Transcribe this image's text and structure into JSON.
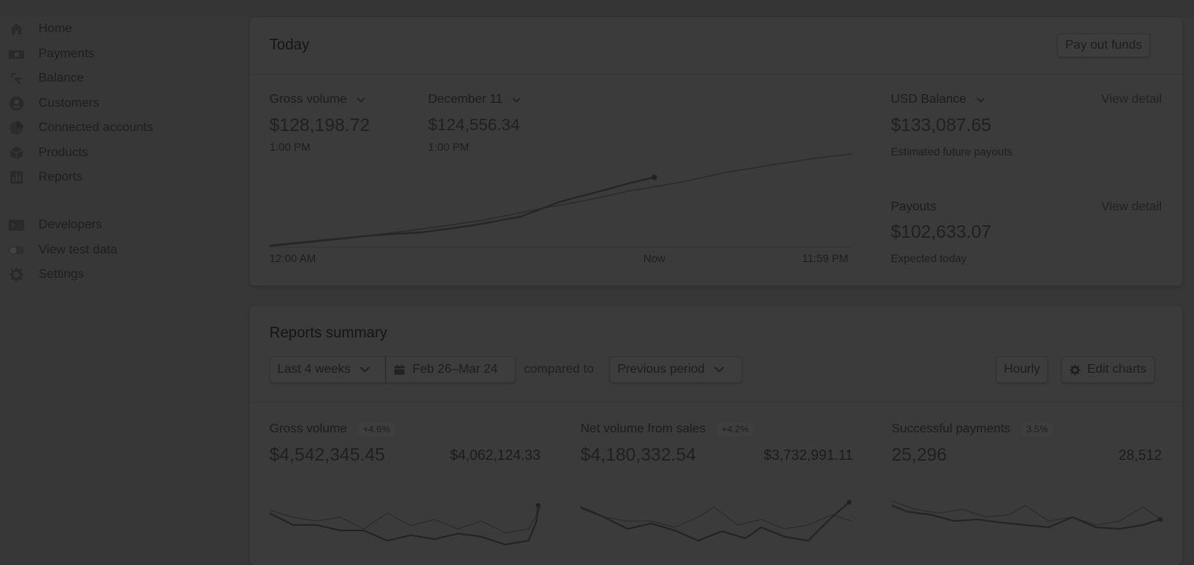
{
  "sidebar": {
    "items": [
      {
        "label": "Home",
        "icon": "home-icon"
      },
      {
        "label": "Payments",
        "icon": "payments-icon"
      },
      {
        "label": "Balance",
        "icon": "balance-icon"
      },
      {
        "label": "Customers",
        "icon": "customers-icon"
      },
      {
        "label": "Connected accounts",
        "icon": "connected-accounts-icon"
      },
      {
        "label": "Products",
        "icon": "products-icon"
      },
      {
        "label": "Reports",
        "icon": "reports-icon"
      },
      {
        "label": "Developers",
        "icon": "developers-icon"
      },
      {
        "label": "View test data",
        "icon": "toggle-icon"
      },
      {
        "label": "Settings",
        "icon": "gear-icon"
      }
    ]
  },
  "today": {
    "title": "Today",
    "payout_button": "Pay out funds",
    "gross": {
      "label": "Gross volume",
      "value": "$128,198.72",
      "time": "1:00 PM"
    },
    "compare": {
      "label": "December 11",
      "value": "$124,556.34",
      "time": "1:00 PM"
    },
    "chart_axis": {
      "start": "12:00 AM",
      "now": "Now",
      "end": "11:59 PM"
    },
    "usd_balance": {
      "label": "USD Balance",
      "link": "View detail",
      "value": "$133,087.65",
      "sub": "Estimated future payouts"
    },
    "payouts": {
      "label": "Payouts",
      "link": "View detail",
      "value": "$102,633.07",
      "sub": "Expected today"
    }
  },
  "reports": {
    "title": "Reports summary",
    "range_select": "Last 4 weeks",
    "date_range": "Feb 26–Mar 24",
    "compared_to": "compared to",
    "compare_select": "Previous period",
    "hourly": "Hourly",
    "edit_charts": "Edit charts",
    "metrics": [
      {
        "label": "Gross volume",
        "badge": "+4.6%",
        "value": "$4,542,345.45",
        "prev": "$4,062,124.33"
      },
      {
        "label": "Net volume from sales",
        "badge": "+4.2%",
        "value": "$4,180,332.54",
        "prev": "$3,732,991.11"
      },
      {
        "label": "Successful payments",
        "badge": "3.5%",
        "value": "25,296",
        "prev": "28,512"
      }
    ]
  },
  "chart_data": {
    "type": "line",
    "x": [
      "12:00 AM",
      "Now",
      "11:59 PM"
    ],
    "series": []
  },
  "colors": {
    "page_bg": "#373737",
    "card_bg": "#3b3b3b",
    "text": "#1a1a1a"
  }
}
